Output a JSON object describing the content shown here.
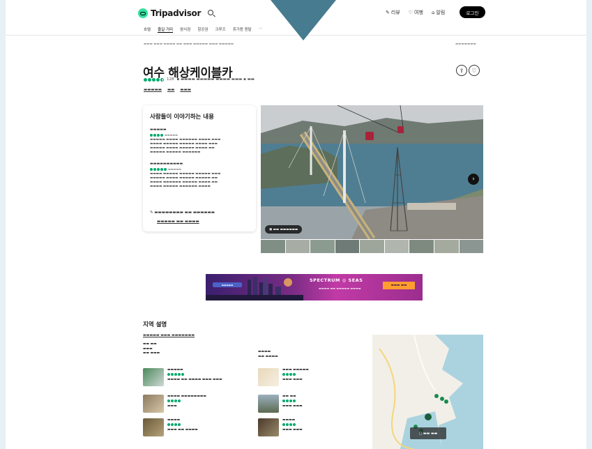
{
  "header": {
    "logo": "Tripadvisor",
    "links": [
      {
        "icon": "pencil-icon",
        "label": "리뷰"
      },
      {
        "icon": "heart-icon",
        "label": "여행"
      },
      {
        "icon": "bell-icon",
        "label": "알림"
      }
    ],
    "login_label": "로그인"
  },
  "nav": [
    "호텔",
    "즐길 거리",
    "음식점",
    "항공권",
    "크루즈",
    "휴가용 렌탈"
  ],
  "page": {
    "title": "여수 해상케이블카",
    "review_count": "128",
    "rating": 4.5
  },
  "reviews_card": {
    "title": "사람들이 이야기하는 내용"
  },
  "colors": {
    "brand_green": "#34e0a1",
    "rating_green": "#00aa6c",
    "ad_orange": "#ff9d2f"
  },
  "ad": {
    "brand": "SPECTRUM ◎ SEAS"
  },
  "area": {
    "title": "지역 설명"
  }
}
